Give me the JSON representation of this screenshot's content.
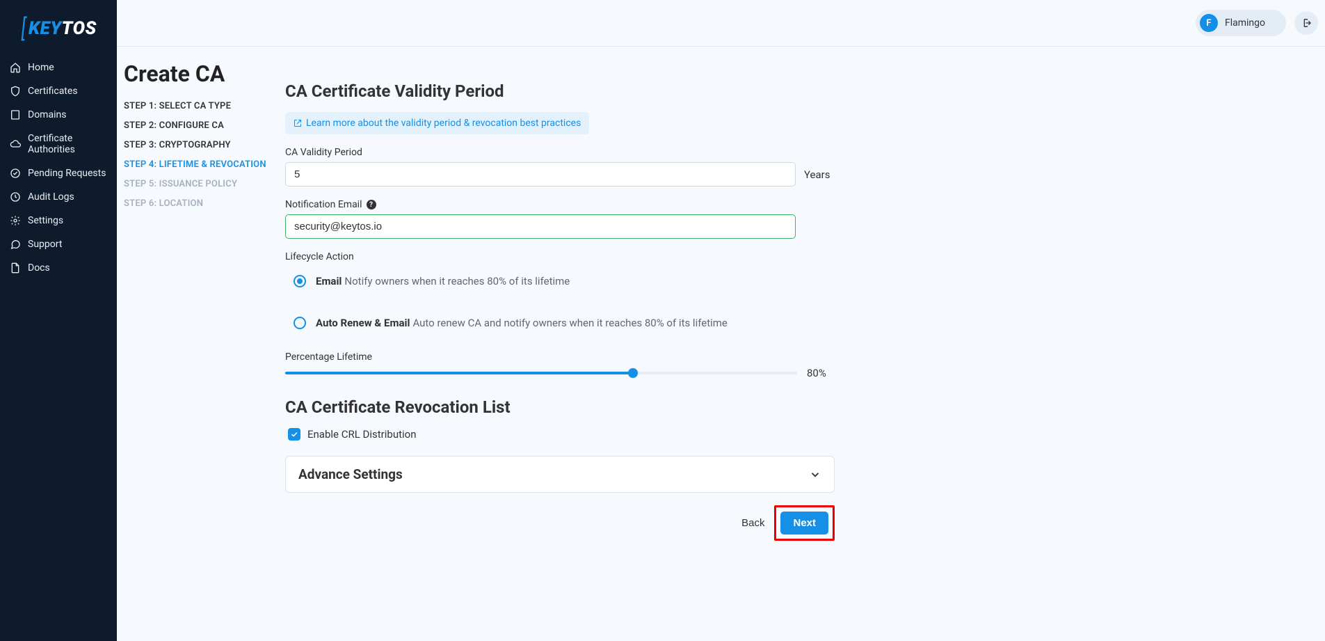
{
  "brand": {
    "key": "KEY",
    "tos": "TOS"
  },
  "nav": {
    "home": "Home",
    "certificates": "Certificates",
    "domains": "Domains",
    "cas": "Certificate Authorities",
    "pending": "Pending Requests",
    "audit": "Audit Logs",
    "settings": "Settings",
    "support": "Support",
    "docs": "Docs"
  },
  "topbar": {
    "user_initial": "F",
    "user_name": "Flamingo"
  },
  "page": {
    "title": "Create CA"
  },
  "steps": {
    "s1": "STEP 1: SELECT CA TYPE",
    "s2": "STEP 2: CONFIGURE CA",
    "s3": "STEP 3: CRYPTOGRAPHY",
    "s4": "STEP 4: LIFETIME & REVOCATION",
    "s5": "STEP 5: ISSUANCE POLICY",
    "s6": "STEP 6: LOCATION"
  },
  "sections": {
    "validity_heading": "CA Certificate Validity Period",
    "learn_more": "Learn more about the validity period & revocation best practices",
    "validity_label": "CA Validity Period",
    "validity_value": "5",
    "validity_unit": "Years",
    "email_label": "Notification Email",
    "email_value": "security@keytos.io",
    "lifecycle_label": "Lifecycle Action",
    "radio_email_title": "Email",
    "radio_email_desc": "Notify owners when it reaches 80% of its lifetime",
    "radio_auto_title": "Auto Renew & Email",
    "radio_auto_desc": "Auto renew CA and notify owners when it reaches 80% of its lifetime",
    "slider_label": "Percentage Lifetime",
    "slider_value": "80%",
    "crl_heading": "CA Certificate Revocation List",
    "crl_checkbox": "Enable CRL Distribution",
    "advance_heading": "Advance Settings"
  },
  "actions": {
    "back": "Back",
    "next": "Next"
  },
  "state": {
    "lifecycle_selected": "email",
    "slider_percent": 68,
    "crl_enabled": true
  }
}
